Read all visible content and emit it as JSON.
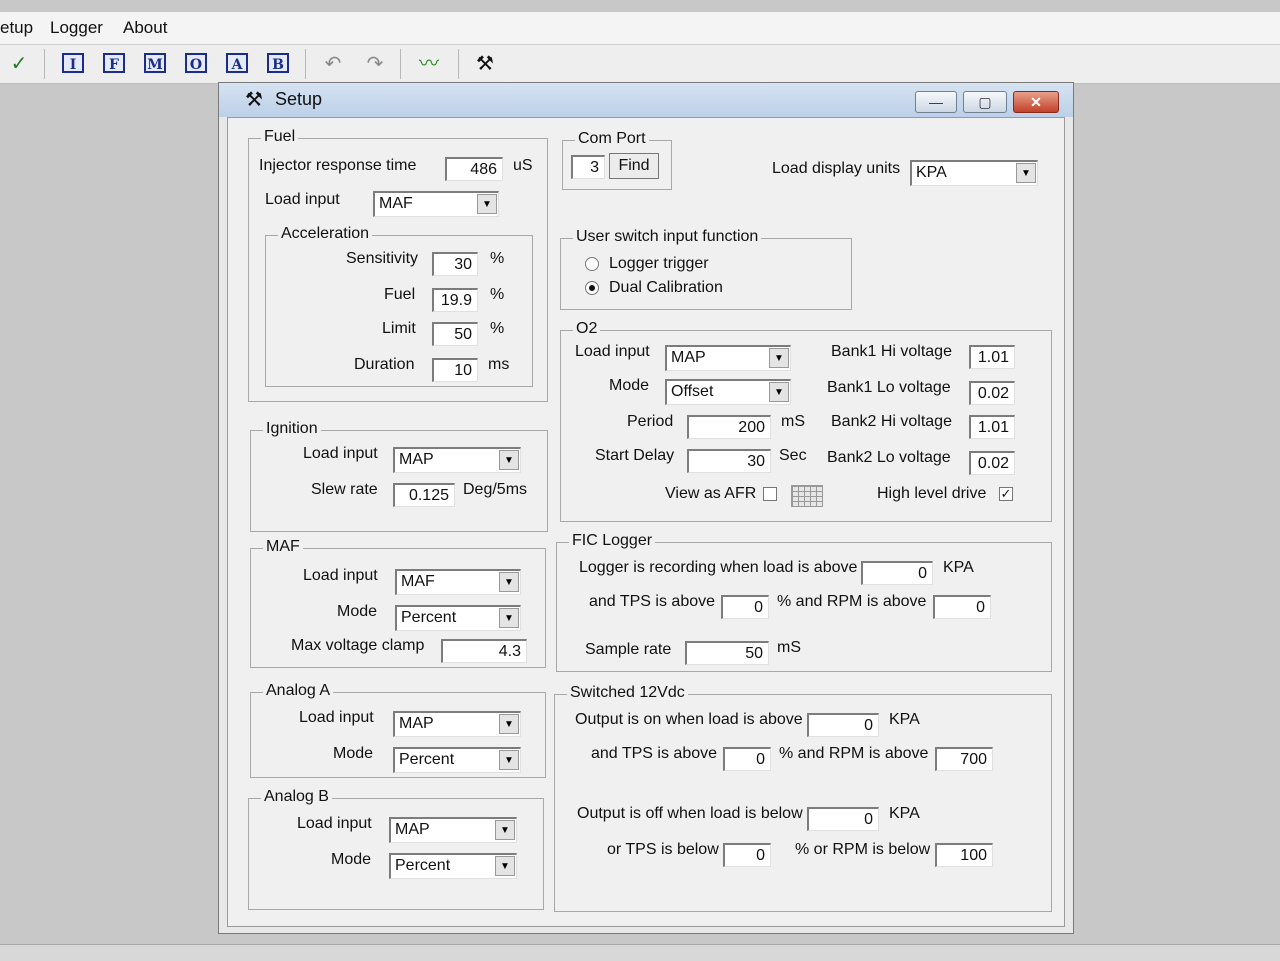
{
  "menu": {
    "setup": "etup",
    "logger": "Logger",
    "about": "About"
  },
  "toolbar": {
    "buttons": [
      "I",
      "F",
      "M",
      "O",
      "A",
      "B"
    ]
  },
  "window": {
    "title": "Setup",
    "min": "—",
    "max": "▢",
    "close": "✕"
  },
  "fuel": {
    "legend": "Fuel",
    "injector_label": "Injector response time",
    "injector_value": "486",
    "injector_unit": "uS",
    "load_label": "Load input",
    "load_value": "MAF",
    "accel": {
      "legend": "Acceleration",
      "sensitivity_label": "Sensitivity",
      "sensitivity_value": "30",
      "sensitivity_unit": "%",
      "fuel_label": "Fuel",
      "fuel_value": "19.9",
      "fuel_unit": "%",
      "limit_label": "Limit",
      "limit_value": "50",
      "limit_unit": "%",
      "duration_label": "Duration",
      "duration_value": "10",
      "duration_unit": "ms"
    }
  },
  "ignition": {
    "legend": "Ignition",
    "load_label": "Load input",
    "load_value": "MAP",
    "slew_label": "Slew rate",
    "slew_value": "0.125",
    "slew_unit": "Deg/5ms"
  },
  "maf": {
    "legend": "MAF",
    "load_label": "Load input",
    "load_value": "MAF",
    "mode_label": "Mode",
    "mode_value": "Percent",
    "clamp_label": "Max voltage clamp",
    "clamp_value": "4.3"
  },
  "analog_a": {
    "legend": "Analog A",
    "load_label": "Load input",
    "load_value": "MAP",
    "mode_label": "Mode",
    "mode_value": "Percent"
  },
  "analog_b": {
    "legend": "Analog B",
    "load_label": "Load input",
    "load_value": "MAP",
    "mode_label": "Mode",
    "mode_value": "Percent"
  },
  "comport": {
    "legend": "Com Port",
    "value": "3",
    "find_label": "Find"
  },
  "load_units": {
    "label": "Load display units",
    "value": "KPA"
  },
  "user_switch": {
    "legend": "User switch input function",
    "opt1": "Logger trigger",
    "opt2": "Dual Calibration",
    "selected": "Dual Calibration"
  },
  "o2": {
    "legend": "O2",
    "load_label": "Load input",
    "load_value": "MAP",
    "mode_label": "Mode",
    "mode_value": "Offset",
    "period_label": "Period",
    "period_value": "200",
    "period_unit": "mS",
    "start_label": "Start Delay",
    "start_value": "30",
    "start_unit": "Sec",
    "b1hi_label": "Bank1 Hi voltage",
    "b1hi_value": "1.01",
    "b1lo_label": "Bank1 Lo voltage",
    "b1lo_value": "0.02",
    "b2hi_label": "Bank2 Hi voltage",
    "b2hi_value": "1.01",
    "b2lo_label": "Bank2 Lo voltage",
    "b2lo_value": "0.02",
    "afr_label": "View as AFR",
    "afr_checked": false,
    "hld_label": "High level drive",
    "hld_checked": true
  },
  "fic": {
    "legend": "FIC Logger",
    "rec_label": "Logger is recording when load is above",
    "rec_value": "0",
    "rec_unit": "KPA",
    "tps_label": "and TPS is above",
    "tps_value": "0",
    "rpm_label": "% and RPM is above",
    "rpm_value": "0",
    "sample_label": "Sample rate",
    "sample_value": "50",
    "sample_unit": "mS"
  },
  "sw12": {
    "legend": "Switched 12Vdc",
    "on_label": "Output is on when load is above",
    "on_value": "0",
    "on_unit": "KPA",
    "on_tps_label": "and TPS is above",
    "on_tps_value": "0",
    "on_rpm_label": "% and RPM is above",
    "on_rpm_value": "700",
    "off_label": "Output is off when load is below",
    "off_value": "0",
    "off_unit": "KPA",
    "off_tps_label": "or TPS is below",
    "off_tps_value": "0",
    "off_rpm_label": "% or RPM is below",
    "off_rpm_value": "100"
  }
}
